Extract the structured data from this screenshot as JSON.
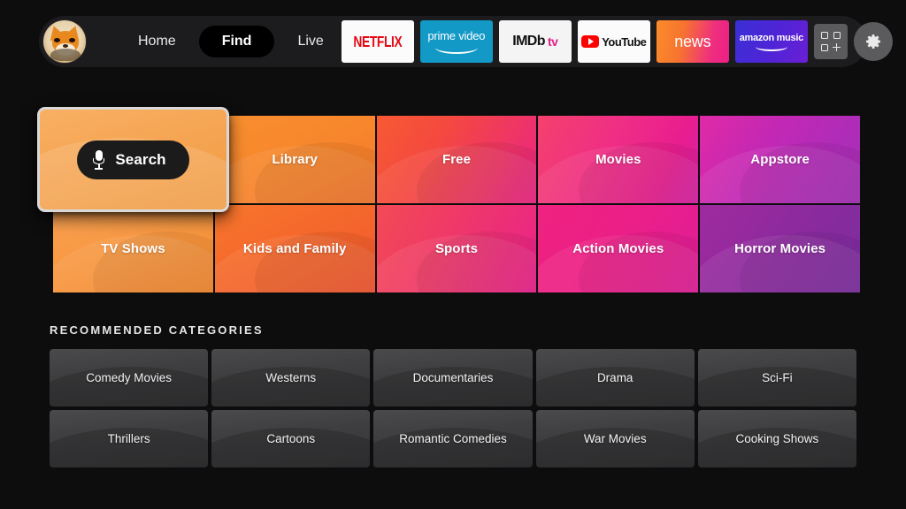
{
  "nav": {
    "avatar_name": "user-avatar",
    "links": [
      {
        "label": "Home",
        "active": false
      },
      {
        "label": "Find",
        "active": true
      },
      {
        "label": "Live",
        "active": false
      }
    ],
    "apps": [
      {
        "name": "netflix",
        "label": "NETFLIX"
      },
      {
        "name": "prime-video",
        "label": "prime video"
      },
      {
        "name": "imdb-tv",
        "label": "IMDb",
        "label2": "tv"
      },
      {
        "name": "youtube",
        "label": "YouTube"
      },
      {
        "name": "news",
        "label": "news"
      },
      {
        "name": "amazon-music",
        "label": "amazon music"
      }
    ],
    "apps_button": "apps-grid-icon",
    "settings_button": "gear-icon"
  },
  "search_tile": {
    "label": "Search",
    "icon": "microphone-icon",
    "focused": true
  },
  "categories": [
    {
      "label": "Library",
      "color": "#f7862c"
    },
    {
      "label": "Free",
      "color": "#f4603c"
    },
    {
      "label": "Movies",
      "color": "#ef2d86"
    },
    {
      "label": "Appstore",
      "color": "#b829b3"
    },
    {
      "label": "TV Shows",
      "color": "#f79a45"
    },
    {
      "label": "Kids and Family",
      "color": "#f4652c"
    },
    {
      "label": "Sports",
      "color": "#ef3a66"
    },
    {
      "label": "Action Movies",
      "color": "#ec1f7e"
    },
    {
      "label": "Horror Movies",
      "color": "#8e2a9e"
    }
  ],
  "recommended": {
    "heading": "Recommended Categories",
    "items": [
      {
        "label": "Comedy Movies"
      },
      {
        "label": "Westerns"
      },
      {
        "label": "Documentaries"
      },
      {
        "label": "Drama"
      },
      {
        "label": "Sci-Fi"
      },
      {
        "label": "Thrillers"
      },
      {
        "label": "Cartoons"
      },
      {
        "label": "Romantic Comedies"
      },
      {
        "label": "War Movies"
      },
      {
        "label": "Cooking Shows"
      }
    ]
  },
  "colors": {
    "background": "#0d0d0e",
    "navbar": "#1c1c1e",
    "active_pill": "#000000",
    "focus_border": "#d8d8d8",
    "tile_gray": "#3e3e40"
  }
}
